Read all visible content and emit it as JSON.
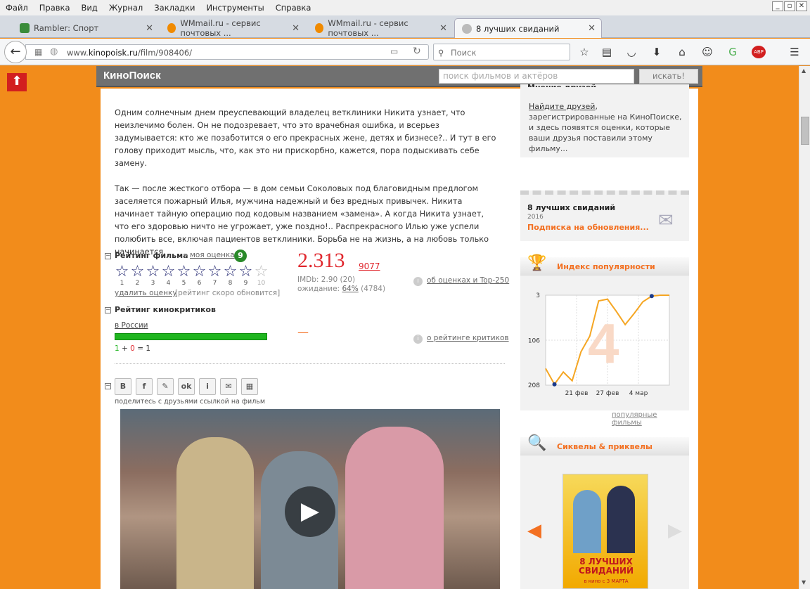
{
  "menu": [
    "Файл",
    "Правка",
    "Вид",
    "Журнал",
    "Закладки",
    "Инструменты",
    "Справка"
  ],
  "tabs": [
    {
      "label": "Rambler: Спорт",
      "color": "#3a8c3a"
    },
    {
      "label": "WMmail.ru - сервис почтовых ...",
      "color": "#f08a00"
    },
    {
      "label": "WMmail.ru - сервис почтовых ...",
      "color": "#f08a00"
    },
    {
      "label": "8 лучших свиданий",
      "color": "#999"
    }
  ],
  "url": {
    "prefix": "www.",
    "domain": "kinopoisk.ru",
    "path": "/film/908406/"
  },
  "browser_search_placeholder": "Поиск",
  "site": {
    "logo": "КиноПоиск",
    "search_placeholder": "поиск фильмов и актёров",
    "search_button": "искать!"
  },
  "description": [
    "Одним солнечным днем преуспевающий владелец ветклиники Никита узнает, что неизлечимо болен. Он не подозревает, что это врачебная ошибка, и всерьез задумывается: кто же позаботится о его прекрасных жене, детях и бизнесе?.. И тут в его голову приходит мысль, что, как это ни прискорбно, кажется, пора подыскивать себе замену.",
    "Так — после жесткого отбора — в дом семьи Соколовых под благовидным предлогом заселяется пожарный Илья, мужчина надежный и без вредных привычек. Никита начинает тайную операцию под кодовым названием «замена». А когда Никита узнает, что его здоровью ничто не угрожает, уже поздно!.. Распрекрасного Илью уже успели полюбить все, включая пациентов ветклиники. Борьба не на жизнь, а на любовь только начинается."
  ],
  "rating": {
    "title": "Рейтинг фильма",
    "my_label": "моя оценка",
    "my_value": "9",
    "delete": "удалить оценку",
    "soon": "[рейтинг скоро обновится]",
    "value": "2.313",
    "votes": "9077",
    "imdb": "IMDb: 2.90 (20)",
    "await_prefix": "ожидание:",
    "await_pct": "64%",
    "await_count": "(4784)",
    "about": "об оценках и Top-250",
    "stars_filled": 9,
    "star_numbers": [
      "1",
      "2",
      "3",
      "4",
      "5",
      "6",
      "7",
      "8",
      "9",
      "10"
    ]
  },
  "critics": {
    "title": "Рейтинг кинокритиков",
    "region": "в России",
    "pos": "1",
    "neg": "0",
    "total": "1",
    "dash": "—",
    "about": "о рейтинге критиков"
  },
  "share": {
    "icons": [
      "vk-icon",
      "facebook-icon",
      "livejournal-icon",
      "odnoklassniki-icon",
      "mailru-icon",
      "email-icon",
      "qrcode-icon"
    ],
    "letters": [
      "B",
      "f",
      "✎",
      "ok",
      "i",
      "✉",
      "▦"
    ],
    "text": "поделитесь с друзьями ссылкой на фильм"
  },
  "sidebar": {
    "friends_title": "Мнение друзей",
    "friends_link": "Найдите друзей",
    "friends_text": ", зарегистрированные на КиноПоиске, и здесь появятся оценки, которые ваши друзья поставили этому фильму...",
    "sub_title": "8 лучших свиданий",
    "sub_year": "2016",
    "sub_link": "Подписка на обновления...",
    "pop_title": "Индекс популярности",
    "pop_more": "популярные фильмы",
    "sequels_title": "Сиквелы & приквелы",
    "poster_text": "8 ЛУЧШИХ СВИДАНИЙ",
    "poster_date": "в кино с 3 МАРТА"
  },
  "chart_data": {
    "type": "line",
    "title": "Индекс популярности",
    "y_ticks": [
      "3",
      "106",
      "208"
    ],
    "x_ticks": [
      "21 фев",
      "27 фев",
      "4 мар"
    ],
    "y_inverted": true,
    "ylim": [
      208,
      3
    ],
    "values": [
      170,
      206,
      178,
      198,
      132,
      96,
      16,
      12,
      40,
      70,
      45,
      18,
      5,
      3,
      3
    ],
    "current": "4",
    "line_color": "#f5a623"
  }
}
